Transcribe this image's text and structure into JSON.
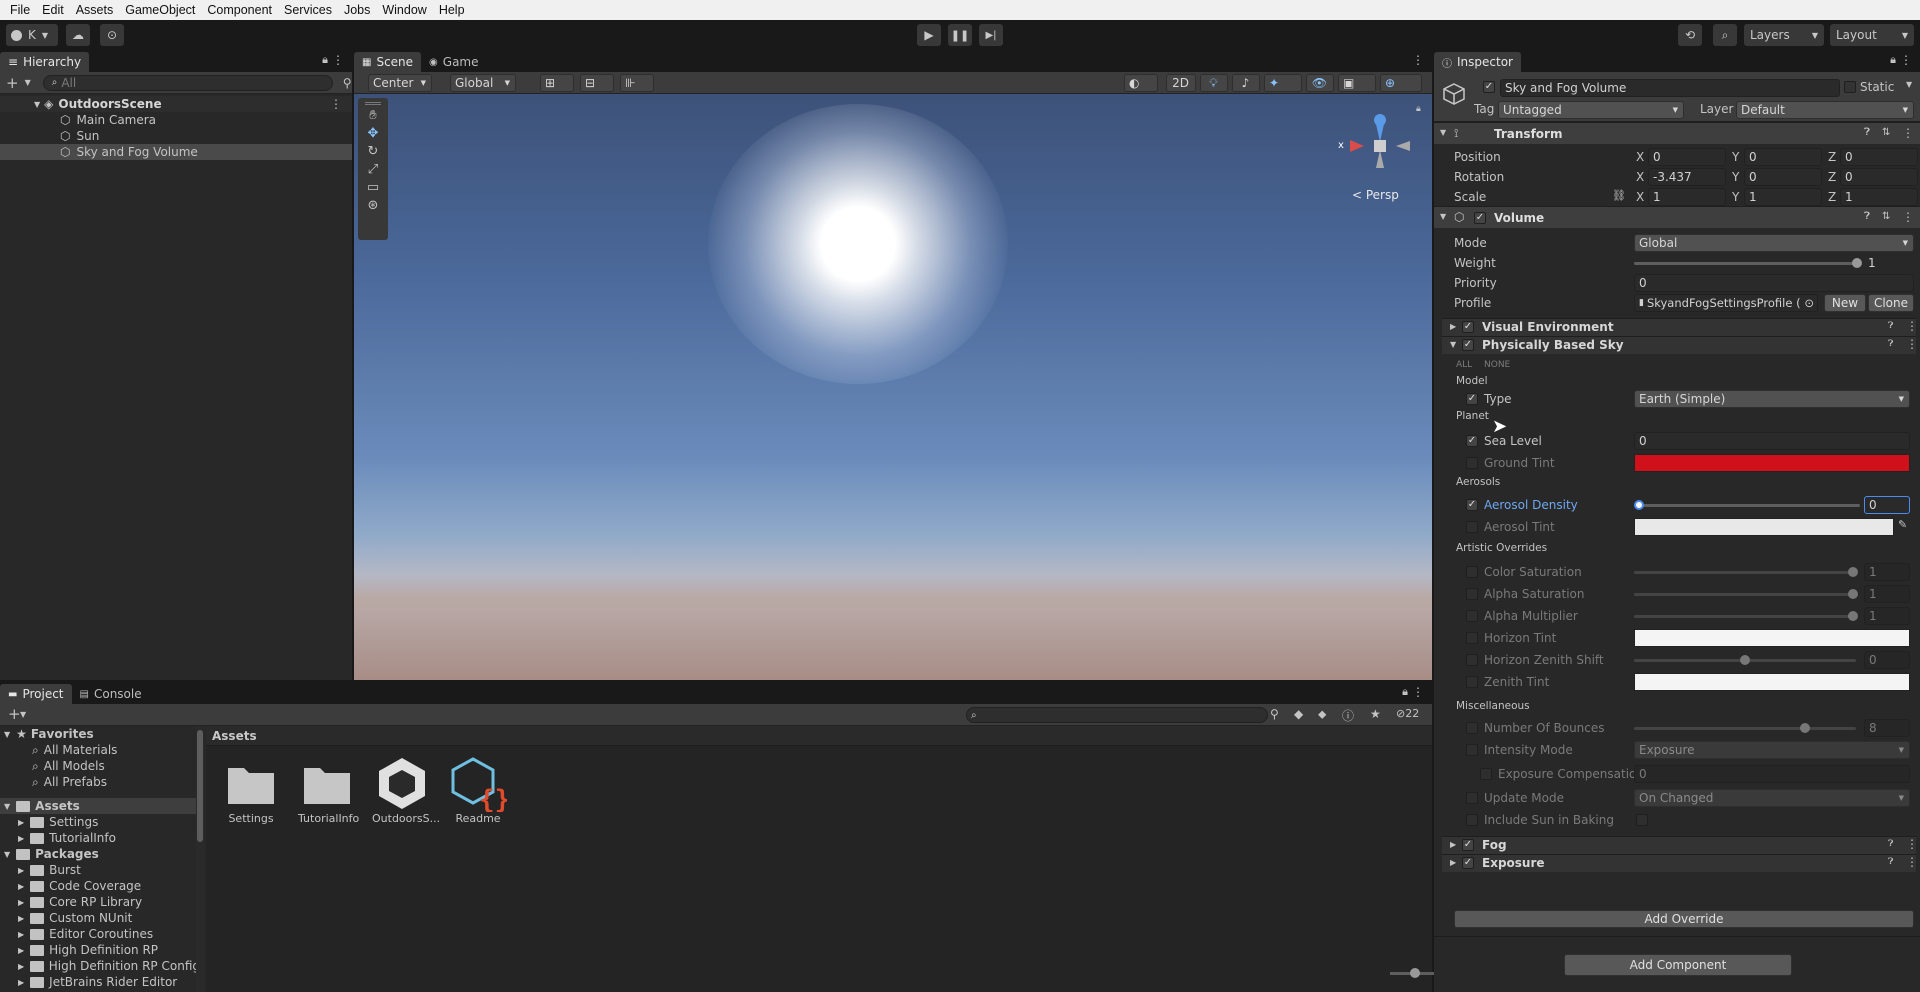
{
  "menu": [
    "File",
    "Edit",
    "Assets",
    "GameObject",
    "Component",
    "Services",
    "Jobs",
    "Window",
    "Help"
  ],
  "toolbar": {
    "account": "K",
    "layers": "Layers",
    "layout": "Layout"
  },
  "hierarchy": {
    "tab": "Hierarchy",
    "search_placeholder": "All",
    "scene": "OutdoorsScene",
    "items": [
      "Main Camera",
      "Sun",
      "Sky and Fog Volume"
    ]
  },
  "scene_view": {
    "tabs": [
      "Scene",
      "Game"
    ],
    "pivot": "Center",
    "space": "Global",
    "mode_2d": "2D",
    "persp": "< Persp",
    "gizmo_x": "x"
  },
  "inspector": {
    "tab": "Inspector",
    "object_name": "Sky and Fog Volume",
    "static_label": "Static",
    "tag_label": "Tag",
    "tag": "Untagged",
    "layer_label": "Layer",
    "layer": "Default",
    "transform": {
      "title": "Transform",
      "rows": [
        {
          "label": "Position",
          "x": "0",
          "y": "0",
          "z": "0"
        },
        {
          "label": "Rotation",
          "x": "-3.437",
          "y": "0",
          "z": "0"
        },
        {
          "label": "Scale",
          "x": "1",
          "y": "1",
          "z": "1"
        }
      ]
    },
    "volume": {
      "title": "Volume",
      "mode_label": "Mode",
      "mode": "Global",
      "weight_label": "Weight",
      "weight": "1",
      "priority_label": "Priority",
      "priority": "0",
      "profile_label": "Profile",
      "profile": "SkyandFogSettingsProfile (",
      "new_btn": "New",
      "clone_btn": "Clone"
    },
    "overrides": {
      "visual_environment": "Visual Environment",
      "pbs": "Physically Based Sky",
      "all": "ALL",
      "none": "NONE",
      "model_header": "Model",
      "type_label": "Type",
      "type_value": "Earth (Simple)",
      "planet_header": "Planet",
      "sea_level_label": "Sea Level",
      "sea_level": "0",
      "ground_tint_label": "Ground Tint",
      "ground_tint_color": "#d0101b",
      "aerosols_header": "Aerosols",
      "aerosol_density_label": "Aerosol Density",
      "aerosol_density": "0",
      "aerosol_tint_label": "Aerosol Tint",
      "artistic_header": "Artistic Overrides",
      "color_saturation_label": "Color Saturation",
      "color_saturation": "1",
      "alpha_saturation_label": "Alpha Saturation",
      "alpha_saturation": "1",
      "alpha_multiplier_label": "Alpha Multiplier",
      "alpha_multiplier": "1",
      "horizon_tint_label": "Horizon Tint",
      "horizon_zenith_label": "Horizon Zenith Shift",
      "horizon_zenith": "0",
      "zenith_tint_label": "Zenith Tint",
      "misc_header": "Miscellaneous",
      "bounces_label": "Number Of Bounces",
      "bounces": "8",
      "intensity_mode_label": "Intensity Mode",
      "intensity_mode": "Exposure",
      "exposure_comp_label": "Exposure Compensation",
      "exposure_comp": "0",
      "update_mode_label": "Update Mode",
      "update_mode": "On Changed",
      "include_sun_label": "Include Sun in Baking",
      "fog": "Fog",
      "exposure": "Exposure",
      "add_override": "Add Override"
    },
    "add_component": "Add Component"
  },
  "project": {
    "tabs": [
      "Project",
      "Console"
    ],
    "hidden_count": "22",
    "favorites_header": "Favorites",
    "favorites": [
      "All Materials",
      "All Models",
      "All Prefabs"
    ],
    "assets_header": "Assets",
    "assets_tree": [
      "Settings",
      "TutorialInfo"
    ],
    "packages_header": "Packages",
    "packages": [
      "Burst",
      "Code Coverage",
      "Core RP Library",
      "Custom NUnit",
      "Editor Coroutines",
      "High Definition RP",
      "High Definition RP Config",
      "JetBrains Rider Editor"
    ],
    "breadcrumb": "Assets",
    "grid": [
      "Settings",
      "TutorialInfo",
      "OutdoorsS...",
      "Readme"
    ]
  }
}
